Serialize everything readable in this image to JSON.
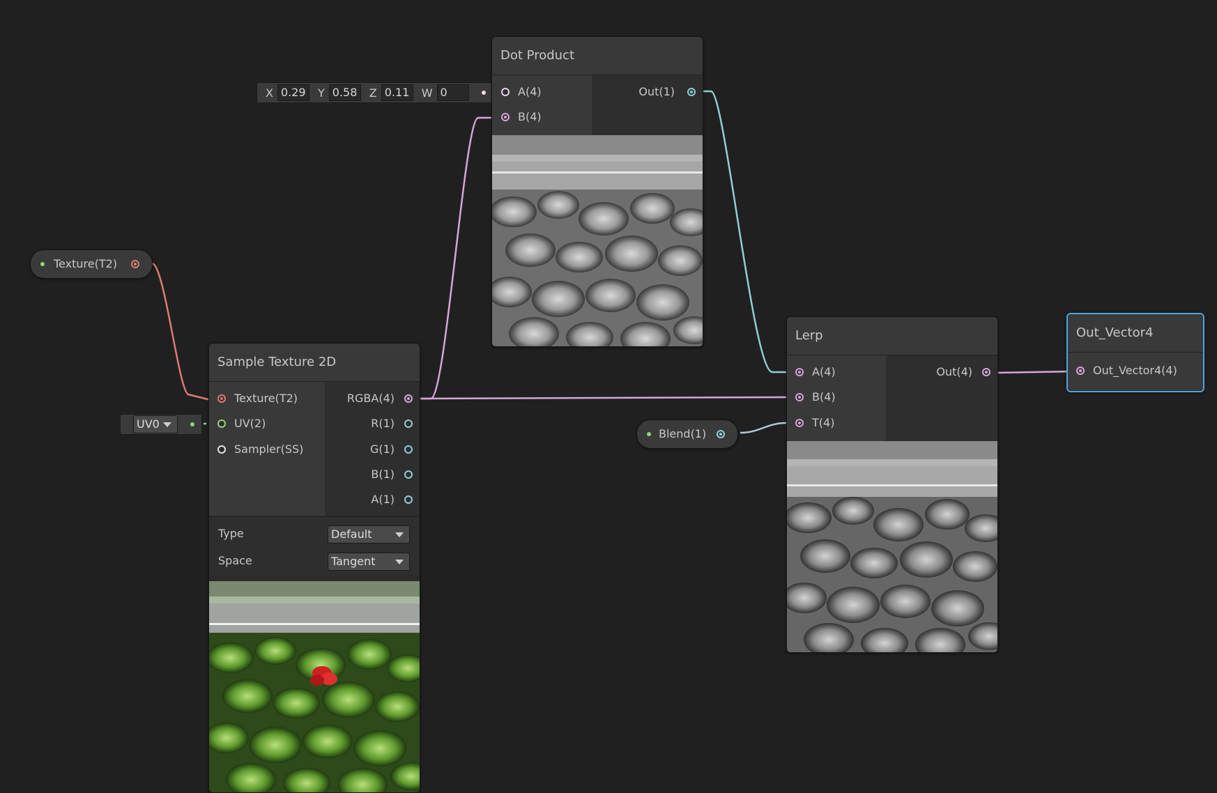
{
  "colors": {
    "background": "#202020",
    "vector_wire": "#d6a6d6",
    "float_wire": "#8fcfd6",
    "texture_wire": "#e07a72",
    "uv_wire": "#8fd67a",
    "selection": "#4aa8e0"
  },
  "dot_product": {
    "title": "Dot Product",
    "inputs": [
      "A(4)",
      "B(4)"
    ],
    "outputs": [
      "Out(1)"
    ],
    "vector_input": {
      "x_label": "X",
      "x": "0.29",
      "y_label": "Y",
      "y": "0.58",
      "z_label": "Z",
      "z": "0.11",
      "w_label": "W",
      "w": "0"
    },
    "preview": "grayscale-foliage-preview"
  },
  "texture_property": {
    "label": "Texture(T2)"
  },
  "sample_texture": {
    "title": "Sample Texture 2D",
    "inputs": [
      "Texture(T2)",
      "UV(2)",
      "Sampler(SS)"
    ],
    "outputs": [
      "RGBA(4)",
      "R(1)",
      "G(1)",
      "B(1)",
      "A(1)"
    ],
    "uv_dropdown": "UV0",
    "type_label": "Type",
    "type_value": "Default",
    "space_label": "Space",
    "space_value": "Tangent",
    "preview": "color-foliage-preview"
  },
  "lerp": {
    "title": "Lerp",
    "inputs": [
      "A(4)",
      "B(4)",
      "T(4)"
    ],
    "outputs": [
      "Out(4)"
    ],
    "preview": "grayscale-foliage-preview"
  },
  "blend_property": {
    "label": "Blend(1)"
  },
  "out_vector": {
    "title": "Out_Vector4",
    "inputs": [
      "Out_Vector4(4)"
    ]
  }
}
